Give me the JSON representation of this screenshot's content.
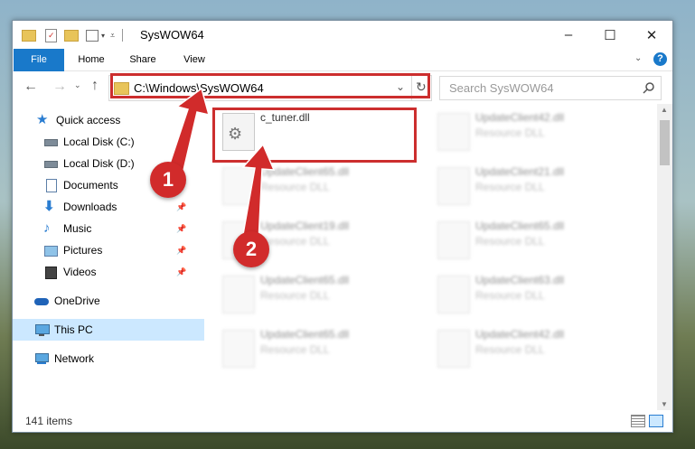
{
  "window": {
    "title": "SysWOW64",
    "controls": {
      "minimize": "–",
      "maximize": "☐",
      "close": "✕"
    }
  },
  "ribbon": {
    "tabs": [
      {
        "label": "File"
      },
      {
        "label": "Home"
      },
      {
        "label": "Share"
      },
      {
        "label": "View"
      }
    ],
    "help_glyph": "?"
  },
  "navigation": {
    "address": "C:\\Windows\\SysWOW64",
    "search_placeholder": "Search SysWOW64"
  },
  "sidebar": {
    "items": [
      {
        "label": "Quick access",
        "icon": "star-icon",
        "pinned": false
      },
      {
        "label": "Local Disk (C:)",
        "icon": "drive-icon",
        "pinned": true
      },
      {
        "label": "Local Disk (D:)",
        "icon": "drive-icon",
        "pinned": true
      },
      {
        "label": "Documents",
        "icon": "documents-icon",
        "pinned": true
      },
      {
        "label": "Downloads",
        "icon": "download-icon",
        "pinned": true
      },
      {
        "label": "Music",
        "icon": "music-icon",
        "pinned": true
      },
      {
        "label": "Pictures",
        "icon": "pictures-icon",
        "pinned": true
      },
      {
        "label": "Videos",
        "icon": "videos-icon",
        "pinned": true
      },
      {
        "label": "OneDrive",
        "icon": "cloud-icon",
        "pinned": false
      },
      {
        "label": "This PC",
        "icon": "computer-icon",
        "pinned": false,
        "selected": true
      },
      {
        "label": "Network",
        "icon": "network-icon",
        "pinned": false
      }
    ]
  },
  "files": {
    "highlighted": {
      "name": "c_tuner.dll"
    },
    "background": [
      {
        "name": "UpdateClient42.dll",
        "type": "Resource DLL"
      },
      {
        "name": "UpdateClient65.dll",
        "type": "Resource DLL"
      },
      {
        "name": "UpdateClient21.dll",
        "type": "Resource DLL"
      },
      {
        "name": "UpdateClient19.dll",
        "type": "Resource DLL"
      },
      {
        "name": "UpdateClient65.dll",
        "type": "Resource DLL"
      },
      {
        "name": "UpdateClient65.dll",
        "type": "Resource DLL"
      },
      {
        "name": "UpdateClient63.dll",
        "type": "Resource DLL"
      },
      {
        "name": "UpdateClient65.dll",
        "type": "Resource DLL"
      },
      {
        "name": "UpdateClient42.dll",
        "type": "Resource DLL"
      }
    ]
  },
  "status": {
    "item_count": "141 items"
  },
  "callouts": [
    {
      "number": "1"
    },
    {
      "number": "2"
    }
  ],
  "colors": {
    "accent": "#1979ca",
    "callout": "#d12b2b",
    "highlight_border": "#cc2e2e",
    "selected_nav": "#cce8ff"
  }
}
